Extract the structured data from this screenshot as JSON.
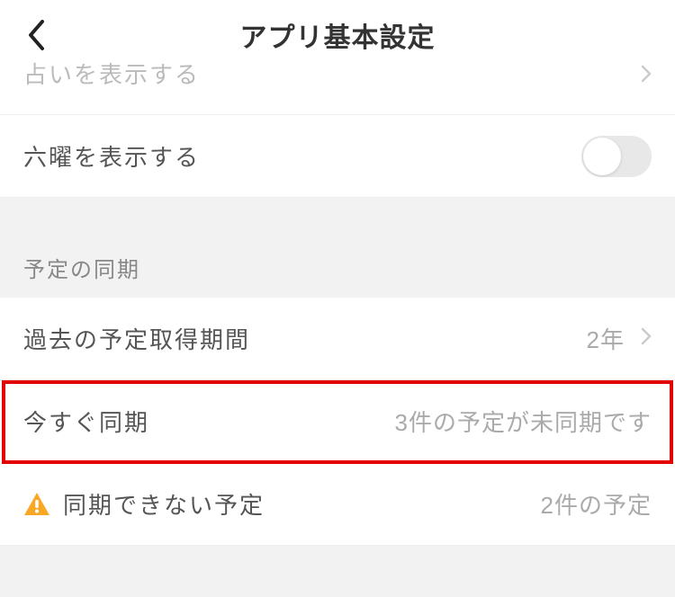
{
  "header": {
    "title": "アプリ基本設定"
  },
  "rows": {
    "fortune": {
      "label": "占いを表示する"
    },
    "rokuyou": {
      "label": "六曜を表示する"
    },
    "past_period": {
      "label": "過去の予定取得期間",
      "value": "2年"
    },
    "sync_now": {
      "label": "今すぐ同期",
      "value": "3件の予定が未同期です"
    },
    "sync_fail": {
      "label": "同期できない予定",
      "value": "2件の予定"
    }
  },
  "sections": {
    "sync": {
      "title": "予定の同期"
    }
  }
}
